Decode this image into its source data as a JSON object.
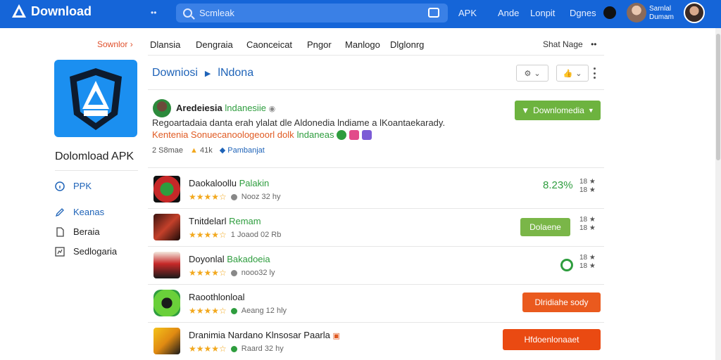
{
  "header": {
    "logo_text": "Download",
    "search_placeholder": "Scmleak",
    "links": [
      "APK",
      "Ande",
      "Lonpit",
      "Dgnes"
    ],
    "user_name": "Sarnlal",
    "user_sub": "Dumam"
  },
  "subnav": {
    "crumb": "Sownlor ›",
    "items": [
      "Dlansia",
      "Dengraia",
      "Caonceicat",
      "Pngor",
      "Manlogo",
      "Dlglonrg"
    ],
    "sort_label": "Shat Nage",
    "more": "••"
  },
  "sidebar": {
    "app_title": "Dolomload APK",
    "items": [
      {
        "label": "PPK",
        "icon": "info-icon"
      },
      {
        "label": "Keanas",
        "icon": "edit-icon"
      },
      {
        "label": "Beraia",
        "icon": "document-icon"
      },
      {
        "label": "Sedlogaria",
        "icon": "chart-icon"
      }
    ]
  },
  "main": {
    "title": "Downiosi",
    "title_sub": "lNdona",
    "developer": {
      "name": "Aredeiesia",
      "tag": "lndanesiie"
    },
    "desc1": "Regoartadaia danta erah ylalat dle Aldonedia lndiame a lKoantaekarady.",
    "desc2_prefix": "Kentenia Sonuecanoologeoorl dolk",
    "desc2_green": "lndaneas",
    "stats": {
      "size": "2 S8mae",
      "downloads": "41k",
      "link": "Pambanjat"
    },
    "download_button": "Downlomedia",
    "colors": {
      "accent": "#1565d8",
      "green": "#6db33f",
      "orange": "#ea5a1e"
    }
  },
  "apps": [
    {
      "name_black": "Daokaloollu",
      "name_green": "Palakin",
      "rating": "★★★★☆",
      "meta": "Nooz 32 hy",
      "right_value": "8.23%",
      "right_meta": "18 ★\n18 ★",
      "action": "none"
    },
    {
      "name_black": "Tnitdelarl",
      "name_green": "Remam",
      "rating": "★★★★☆",
      "meta": "1 Joaod 02 Rb",
      "right_value": "",
      "right_meta": "18 ★\n18 ★",
      "action": "Dolaene"
    },
    {
      "name_black": "Doyonlal",
      "name_green": "Bakadoeia",
      "rating": "★★★★☆",
      "meta": "nooo32 ly",
      "right_value": "",
      "right_meta": "18 ★\n18 ★",
      "action": "refresh"
    },
    {
      "name_black": "Raoothlonloal",
      "name_green": "",
      "rating": "★★★★☆",
      "meta": "Aeang 12 hly",
      "right_value": "",
      "right_meta": "",
      "action": "Dlridiahe sody"
    },
    {
      "name_black": "Dranimia Nardano Klnsosar Paarla",
      "name_green": "",
      "rating": "★★★★☆",
      "meta": "Raard 32 hy",
      "right_value": "",
      "right_meta": "",
      "action": "Hfdoenlonaaet"
    }
  ]
}
